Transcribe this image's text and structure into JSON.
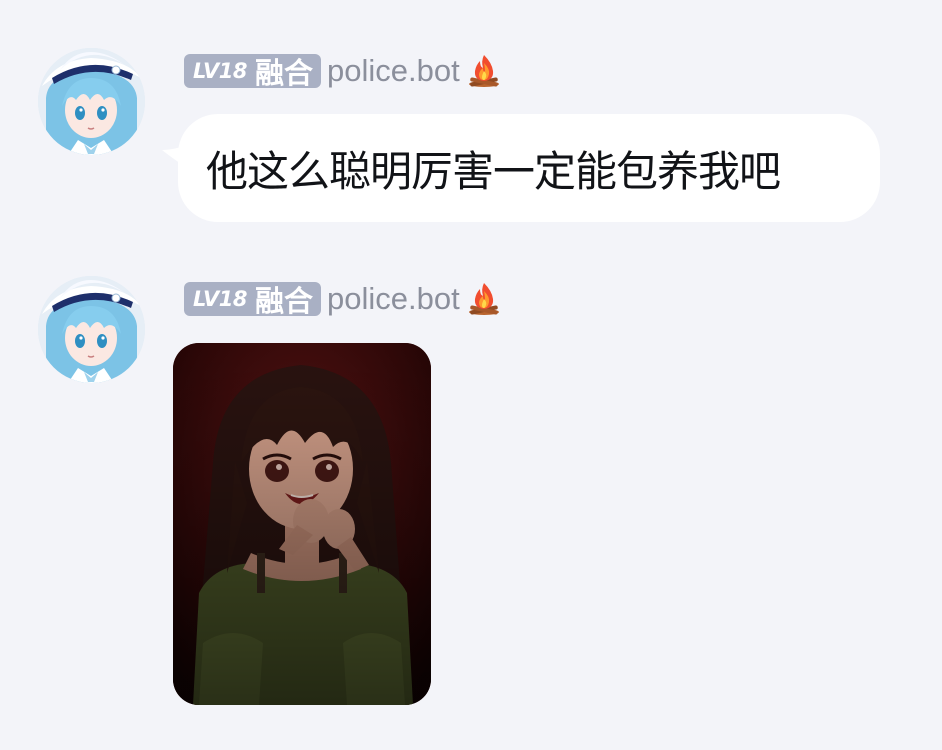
{
  "messages": [
    {
      "level": "LV18",
      "level_title": "融合",
      "username": "police.bot",
      "avatar_icon": "anime-girl-avatar",
      "badge_icon": "fire-icon",
      "text": "他这么聪明厉害一定能包养我吧"
    },
    {
      "level": "LV18",
      "level_title": "融合",
      "username": "police.bot",
      "avatar_icon": "anime-girl-avatar",
      "badge_icon": "fire-icon",
      "image": "anime-girl-image"
    }
  ],
  "colors": {
    "background": "#f3f4f9",
    "bubble": "#ffffff",
    "level_badge": "#a9b0c4",
    "username": "#8b8f9c",
    "text": "#111317"
  }
}
